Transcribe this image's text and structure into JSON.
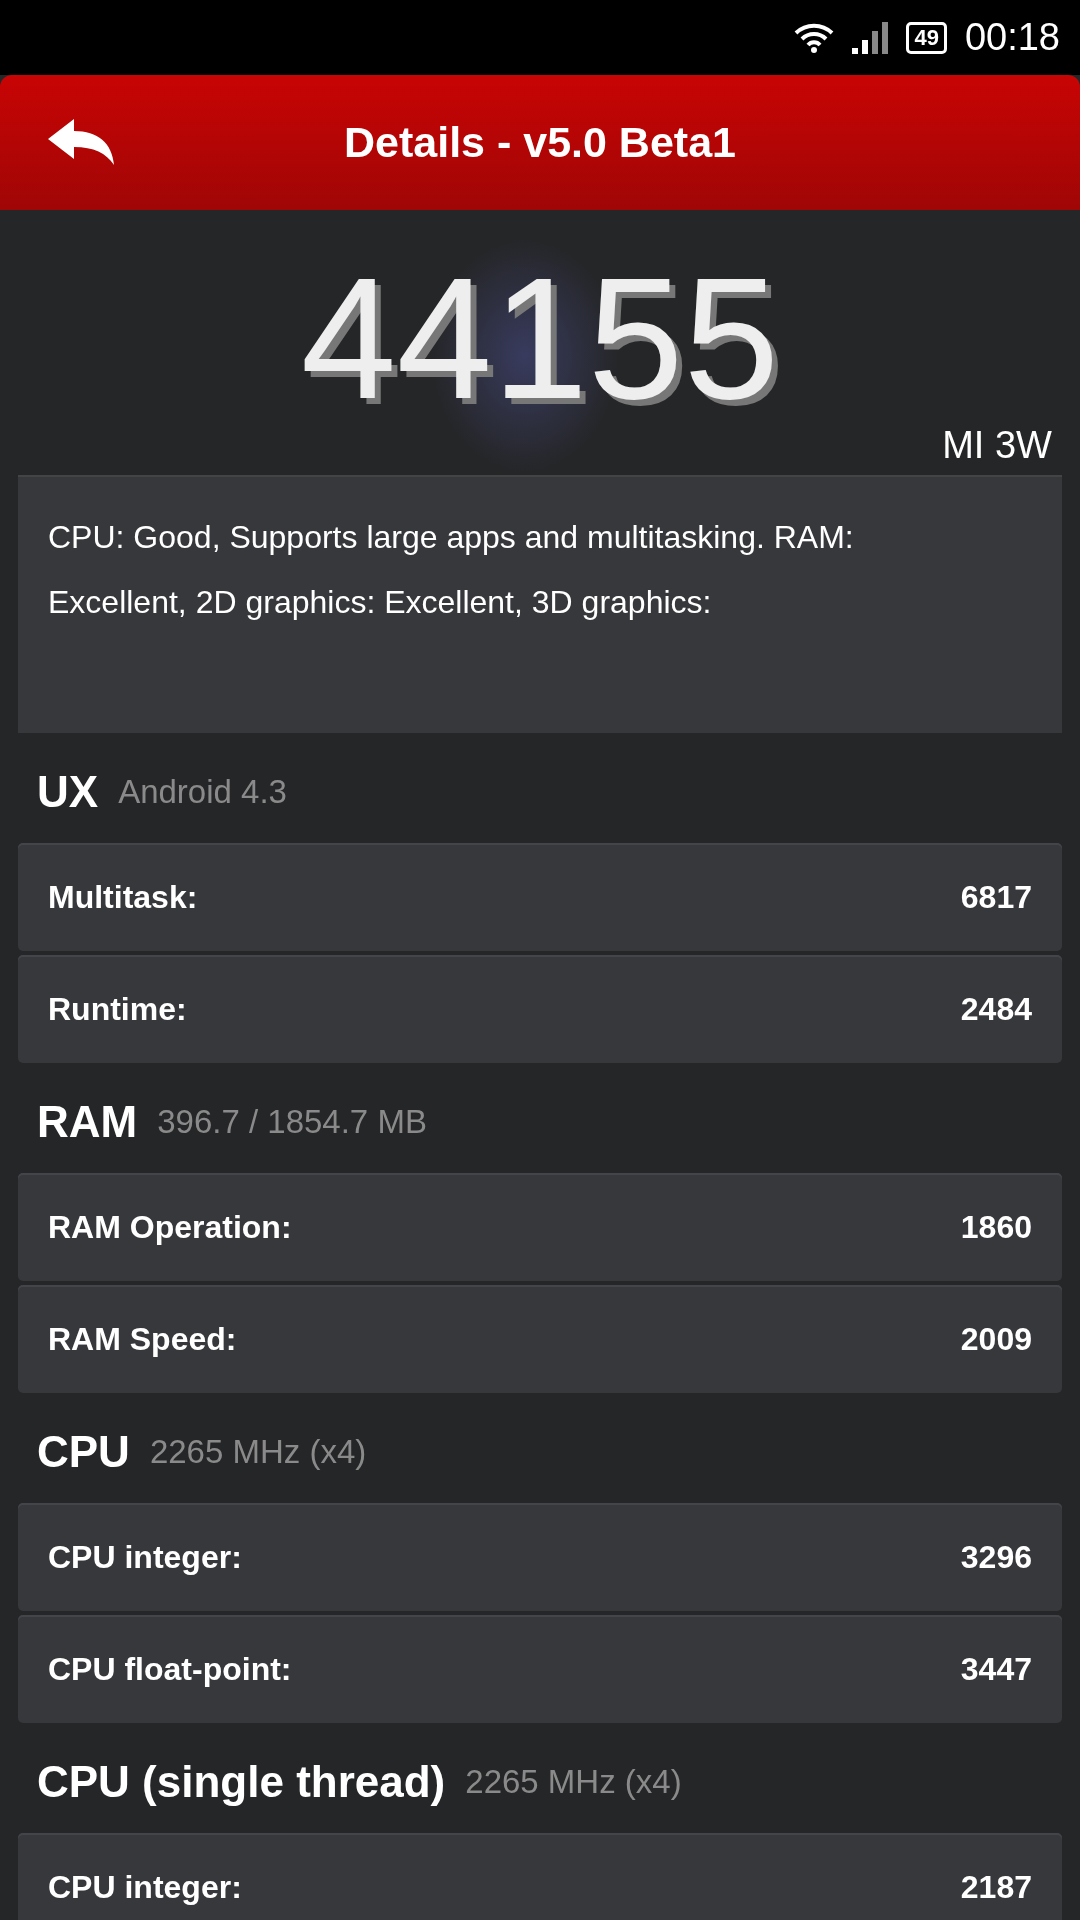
{
  "status_bar": {
    "battery": "49",
    "time": "00:18"
  },
  "header": {
    "title": "Details - v5.0 Beta1"
  },
  "score": {
    "value": "44155",
    "device": "MI 3W"
  },
  "summary": "CPU: Good, Supports large apps and multitasking. RAM: Excellent, 2D graphics: Excellent, 3D graphics:",
  "sections": [
    {
      "title": "UX",
      "subtitle": "Android 4.3",
      "rows": [
        {
          "label": "Multitask:",
          "value": "6817"
        },
        {
          "label": "Runtime:",
          "value": "2484"
        }
      ]
    },
    {
      "title": "RAM",
      "subtitle": "396.7 / 1854.7 MB",
      "rows": [
        {
          "label": "RAM Operation:",
          "value": "1860"
        },
        {
          "label": "RAM Speed:",
          "value": "2009"
        }
      ]
    },
    {
      "title": "CPU",
      "subtitle": "2265 MHz (x4)",
      "rows": [
        {
          "label": "CPU integer:",
          "value": "3296"
        },
        {
          "label": "CPU float-point:",
          "value": "3447"
        }
      ]
    },
    {
      "title": "CPU (single thread)",
      "subtitle": "2265 MHz (x4)",
      "rows": [
        {
          "label": "CPU integer:",
          "value": "2187"
        }
      ]
    }
  ]
}
